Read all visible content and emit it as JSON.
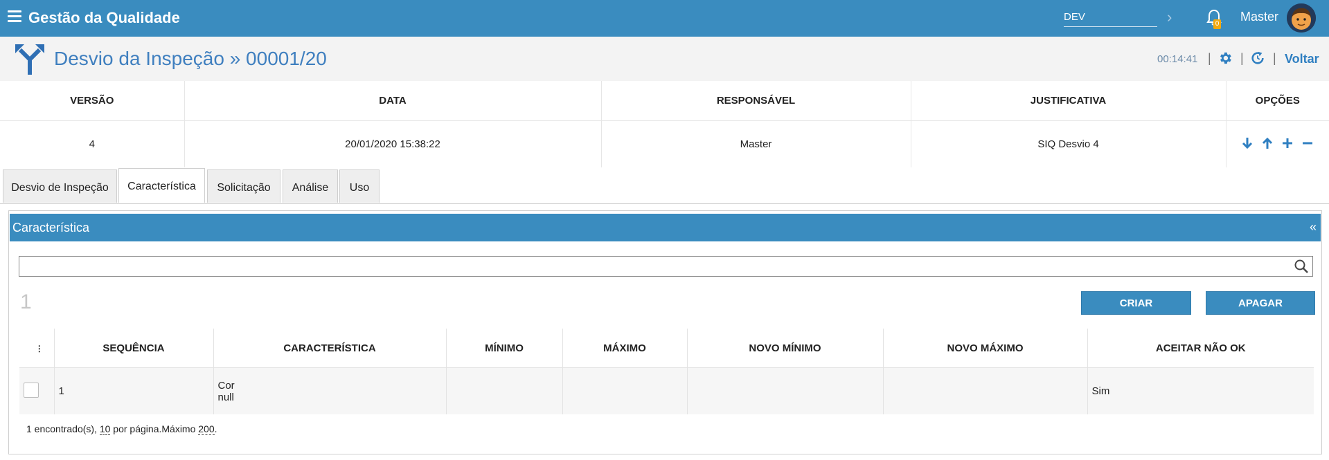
{
  "header": {
    "menu_icon": "hamburger-icon",
    "app_title": "Gestão da Qualidade",
    "environment_value": "DEV",
    "notification_count": "0",
    "user_name": "Master",
    "accent_color": "#3a8cbf"
  },
  "titlebar": {
    "title": "Desvio da Inspeção » 00001/20",
    "timer": "00:14:41",
    "back_label": "Voltar",
    "icons": [
      "fork-icon",
      "gear-icon",
      "refresh-clock-icon"
    ]
  },
  "versions": {
    "columns": [
      "VERSÃO",
      "DATA",
      "RESPONSÁVEL",
      "JUSTIFICATIVA",
      "OPÇÕES"
    ],
    "rows": [
      {
        "versao": "4",
        "data": "20/01/2020 15:38:22",
        "responsavel": "Master",
        "justificativa": "SIQ Desvio 4"
      }
    ],
    "option_icons": [
      "arrow-down-icon",
      "arrow-up-icon",
      "plus-icon",
      "minus-icon"
    ]
  },
  "tabs": [
    {
      "label": "Desvio de Inspeção",
      "active": false
    },
    {
      "label": "Característica",
      "active": true
    },
    {
      "label": "Solicitação",
      "active": false
    },
    {
      "label": "Análise",
      "active": false
    },
    {
      "label": "Uso",
      "active": false
    }
  ],
  "panel": {
    "title": "Característica",
    "collapse_label": "«",
    "search_value": "",
    "count": "1",
    "create_label": "CRIAR",
    "delete_label": "APAGAR"
  },
  "grid": {
    "columns": [
      "SEQUÊNCIA",
      "CARACTERÍSTICA",
      "MÍNIMO",
      "MÁXIMO",
      "NOVO MÍNIMO",
      "NOVO MÁXIMO",
      "ACEITAR NÃO OK"
    ],
    "rows": [
      {
        "sequencia": "1",
        "caracteristica_line1": "Cor",
        "caracteristica_line2": "null",
        "minimo": "",
        "maximo": "",
        "novo_minimo": "",
        "novo_maximo": "",
        "aceitar": "Sim"
      }
    ]
  },
  "footer": {
    "found_text": "1 encontrado(s), ",
    "per_page_value": "10",
    "per_page_text": " por página.Máximo ",
    "max_value": "200",
    "end_text": "."
  }
}
